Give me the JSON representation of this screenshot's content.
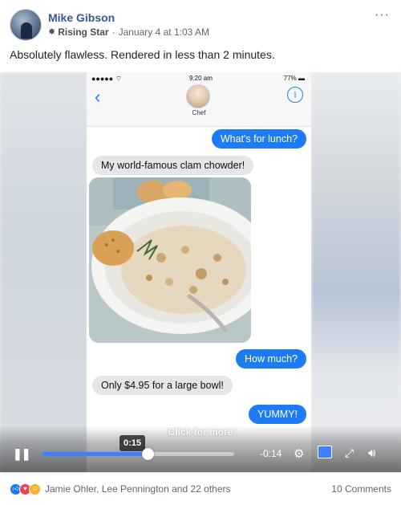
{
  "post": {
    "author": "Mike Gibson",
    "badge": "Rising Star",
    "separator": "·",
    "timestamp": "January 4 at 1:03 AM",
    "text": "Absolutely flawless. Rendered in less than 2 minutes.",
    "more_icon": "more-dots-icon"
  },
  "phone": {
    "status": {
      "signal": "••••• ",
      "time": "9:20 am",
      "battery": "77%"
    },
    "nav": {
      "back_glyph": "‹",
      "contact_name": "Chef",
      "info_glyph": "i"
    },
    "messages": [
      {
        "text": "What's for lunch?",
        "direction": "outgoing"
      },
      {
        "text": "My world-famous clam chowder!",
        "direction": "incoming"
      },
      {
        "text": "How much?",
        "direction": "outgoing"
      },
      {
        "text": "Only $4.95 for a large bowl!",
        "direction": "incoming"
      },
      {
        "text": "YUMMY!",
        "direction": "outgoing"
      }
    ],
    "bubble_colors": {
      "outgoing": "#1d7bf6",
      "incoming": "#e5e5ea"
    }
  },
  "video_controls": {
    "overlay_text": "Click for more",
    "hover_time": "0:15",
    "remaining_time": "-0:14",
    "progress_fraction": 0.55,
    "pause_glyph": "❚❚",
    "icons": [
      "pause-icon",
      "settings-gear-icon",
      "hd-icon",
      "fullscreen-icon",
      "volume-icon"
    ]
  },
  "footer": {
    "reactions": [
      "like-icon",
      "love-icon",
      "haha-icon"
    ],
    "reactors": "Jamie Ohler, Lee Pennington and 22 others",
    "comments": "10 Comments"
  }
}
